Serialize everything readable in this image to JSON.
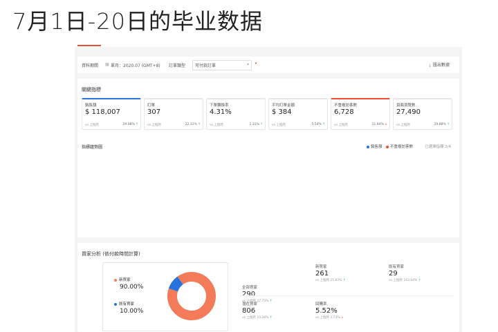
{
  "title": "7月1日-20日的毕业数据",
  "nav": {
    "tabs": [
      "",
      "",
      "",
      "",
      ""
    ]
  },
  "filter": {
    "period_label": "資料期間",
    "period_value": "單月：2020.07 (GMT+8)",
    "order_type_label": "訂單類型",
    "order_type_value": "可付款訂單",
    "export_label": "匯出數據"
  },
  "key_metrics": {
    "heading": "關鍵指標",
    "cards": [
      {
        "label": "銷售額",
        "value": "$ 118,007",
        "compare": "vs.上個月",
        "change": "29.08%",
        "dir": "up",
        "selected": "blue"
      },
      {
        "label": "訂單",
        "value": "307",
        "compare": "vs.上個月",
        "change": "22.31%",
        "dir": "up",
        "selected": ""
      },
      {
        "label": "下單轉換率",
        "value": "4.31%",
        "compare": "vs.上個月",
        "change": "1.31%",
        "dir": "up",
        "selected": ""
      },
      {
        "label": "平均訂單金額",
        "value": "$ 384",
        "compare": "vs.上個月",
        "change": "5.54%",
        "dir": "up",
        "selected": ""
      },
      {
        "label": "不重複訪客數",
        "value": "6,728",
        "compare": "vs.上個月",
        "change": "11.84%",
        "dir": "down",
        "selected": "orange"
      },
      {
        "label": "頁面瀏覽數",
        "value": "27,490",
        "compare": "vs.上個月",
        "change": "29.88%",
        "dir": "up",
        "selected": ""
      }
    ],
    "trend_label": "指標趨勢圖",
    "legend": [
      {
        "name": "銷售額",
        "color": "#2673dd"
      },
      {
        "name": "不重複訪客數",
        "color": "#ee4d2d"
      }
    ],
    "selected_count": "已選擇指標 2/4"
  },
  "buyer_analysis": {
    "heading": "買家分析 (依付款時間計算)",
    "donut": [
      {
        "name": "新買家",
        "pct_label": "90.00%",
        "value": 90.0,
        "color": "#f47b5a"
      },
      {
        "name": "既有買家",
        "pct_label": "10.00%",
        "value": 10.0,
        "color": "#2673dd"
      }
    ],
    "stats": [
      {
        "label": "全部買家",
        "value": "290",
        "compare": "vs.上個月",
        "change": "27.75%",
        "dir": "up"
      },
      {
        "label": "新買家",
        "value": "261",
        "compare": "vs.上個月",
        "change": "25.83%",
        "dir": "up"
      },
      {
        "label": "既有買家",
        "value": "29",
        "compare": "vs.上個月",
        "change": "163.64%",
        "dir": "up"
      },
      {
        "label": "潛在買家",
        "value": "806",
        "compare": "vs.上個月",
        "change": "10.26%",
        "dir": "up"
      },
      {
        "label": "回購率",
        "value": "5.52%",
        "compare": "vs.上個月",
        "change": "3.73%",
        "dir": "down"
      }
    ]
  }
}
